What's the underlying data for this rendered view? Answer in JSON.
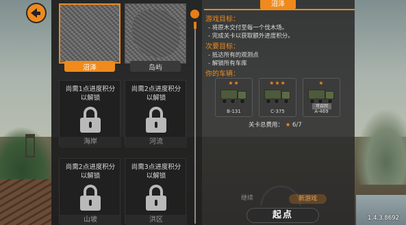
{
  "maps": {
    "selected": {
      "label": "沼泽"
    },
    "island": {
      "label": "岛屿"
    },
    "locked": [
      {
        "requirement": "尚需1点进度积分以解锁",
        "name": "海岸"
      },
      {
        "requirement": "尚需2点进度积分以解锁",
        "name": "河流"
      },
      {
        "requirement": "尚需2点进度积分以解锁",
        "name": "山坡"
      },
      {
        "requirement": "尚需3点进度积分以解锁",
        "name": "洪区"
      }
    ]
  },
  "info": {
    "tab": "沼泽",
    "goals_title": "游戏目标：",
    "goals": [
      "- 将原木交付至每一个伐木场。",
      "- 完成关卡以获取额外进度积分。"
    ],
    "secondary_title": "次要目标：",
    "secondary": [
      "- 抵达所有的观测点",
      "- 解锁所有车库"
    ],
    "vehicles_title": "你的车辆：",
    "vehicles": [
      {
        "stars": "★★",
        "code": "B-131",
        "badge": ""
      },
      {
        "stars": "★★★",
        "code": "C-375",
        "badge": ""
      },
      {
        "stars": "★",
        "code": "A-469",
        "badge": "可召回"
      }
    ],
    "cost_label": "关卡总费用：",
    "cost_star": "★",
    "cost_value": "6/7"
  },
  "controls": {
    "mode_left": "继续",
    "mode_right": "新游戏",
    "start": "起点"
  },
  "version": "1.4.3.8692",
  "colors": {
    "accent": "#f08a1c",
    "panel": "#1e1e1e"
  }
}
